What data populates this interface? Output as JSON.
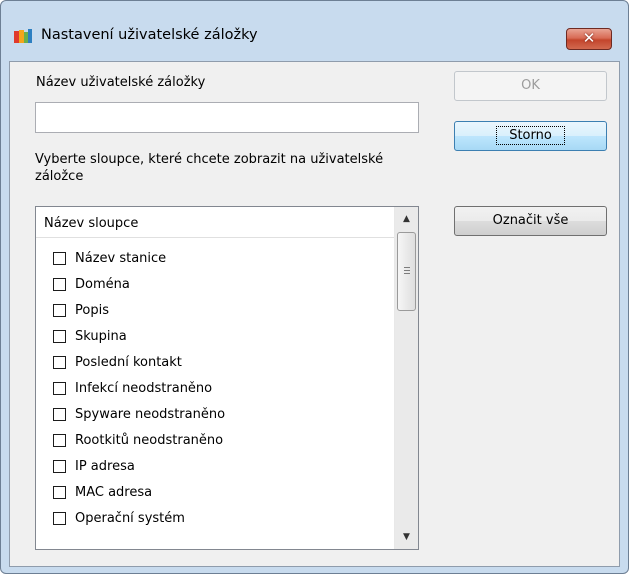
{
  "window": {
    "title": "Nastavení uživatelské záložky",
    "close_glyph": "✕",
    "app_icon": "avg-logo-icon"
  },
  "form": {
    "name_label": "Název uživatelské záložky",
    "name_value": "",
    "columns_label": "Vyberte sloupce, které chcete zobrazit na uživatelské záložce"
  },
  "buttons": {
    "ok": "OK",
    "cancel": "Storno",
    "select_all": "Označit vše"
  },
  "list": {
    "header": "Název sloupce",
    "items": [
      {
        "label": "Název stanice",
        "checked": false
      },
      {
        "label": "Doména",
        "checked": false
      },
      {
        "label": "Popis",
        "checked": false
      },
      {
        "label": "Skupina",
        "checked": false
      },
      {
        "label": "Poslední kontakt",
        "checked": false
      },
      {
        "label": "Infekcí neodstraněno",
        "checked": false
      },
      {
        "label": "Spyware neodstraněno",
        "checked": false
      },
      {
        "label": "Rootkitů neodstraněno",
        "checked": false
      },
      {
        "label": "IP adresa",
        "checked": false
      },
      {
        "label": "MAC adresa",
        "checked": false
      },
      {
        "label": "Operační systém",
        "checked": false
      }
    ]
  }
}
